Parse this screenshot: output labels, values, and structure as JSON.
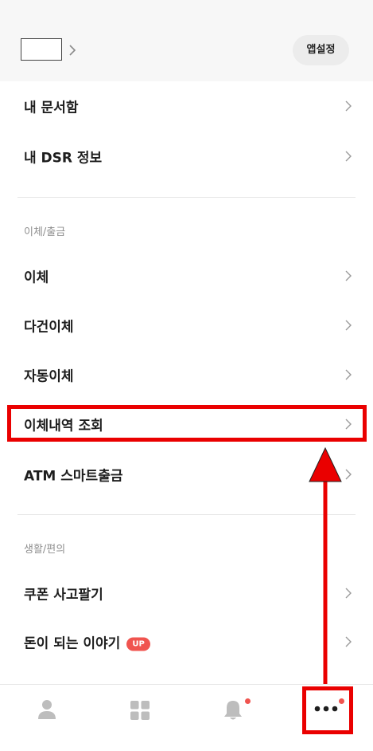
{
  "header": {
    "app_setting_label": "앱설정"
  },
  "menu": {
    "my_documents": "내 문서함",
    "my_dsr": "내 DSR 정보",
    "section_transfer": "이체/출금",
    "transfer": "이체",
    "multi_transfer": "다건이체",
    "auto_transfer": "자동이체",
    "transfer_history": "이체내역 조회",
    "atm_smart": "ATM 스마트출금",
    "section_life": "생활/편의",
    "coupon": "쿠폰 사고팔기",
    "money_story": "돈이 되는 이야기",
    "up_badge": "UP"
  },
  "icons": {
    "chevron": "chevron-right-icon",
    "profile": "person-icon",
    "grid": "grid-icon",
    "bell": "bell-icon",
    "more": "more-dots-icon"
  },
  "colors": {
    "accent": "#f0544f",
    "highlight": "#ea0000"
  }
}
